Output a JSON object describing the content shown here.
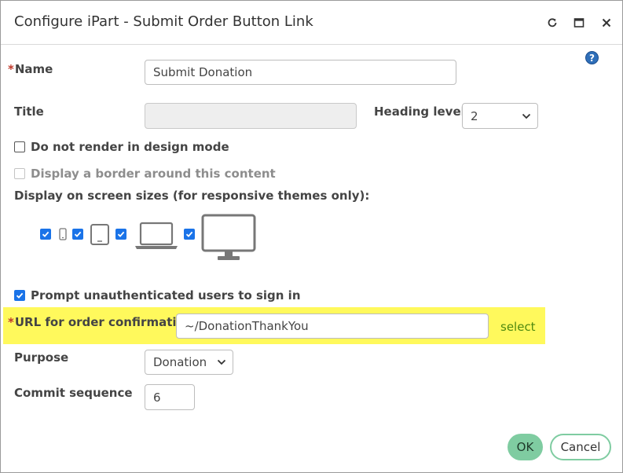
{
  "dialog": {
    "title": "Configure iPart - Submit Order Button Link",
    "controls": {
      "refresh_icon": "refresh-icon",
      "maximize_icon": "maximize-icon",
      "close_icon": "close-icon"
    },
    "help_glyph": "?"
  },
  "form": {
    "name": {
      "required_mark": "*",
      "label": "Name",
      "value": "Submit Donation"
    },
    "title": {
      "label": "Title",
      "value": ""
    },
    "heading_level": {
      "label": "Heading level",
      "value": "2"
    },
    "do_not_render": {
      "label": "Do not render in design mode",
      "checked": false
    },
    "display_border": {
      "label": "Display a border around this content",
      "checked": false,
      "disabled": true
    },
    "screen_sizes": {
      "label": "Display on screen sizes (for responsive themes only):",
      "devices": [
        {
          "icon": "phone-icon",
          "checked": true
        },
        {
          "icon": "tablet-icon",
          "checked": true
        },
        {
          "icon": "laptop-icon",
          "checked": true
        },
        {
          "icon": "desktop-monitor-icon",
          "checked": true
        }
      ]
    },
    "prompt_signin": {
      "label": "Prompt unauthenticated users to sign in",
      "checked": true
    },
    "order_url": {
      "required_mark": "*",
      "label": "URL for order confirmation",
      "value": "~/DonationThankYou",
      "select_link": "select"
    },
    "purpose": {
      "label": "Purpose",
      "value": "Donation"
    },
    "commit_sequence": {
      "label": "Commit sequence",
      "value": "6"
    }
  },
  "buttons": {
    "ok": "OK",
    "cancel": "Cancel"
  },
  "colors": {
    "accent_green": "#7fcca1",
    "checkbox_blue": "#1a73e8",
    "highlight_yellow": "#fff95c",
    "link_green": "#4f8a10",
    "required_red": "#c0392b"
  }
}
